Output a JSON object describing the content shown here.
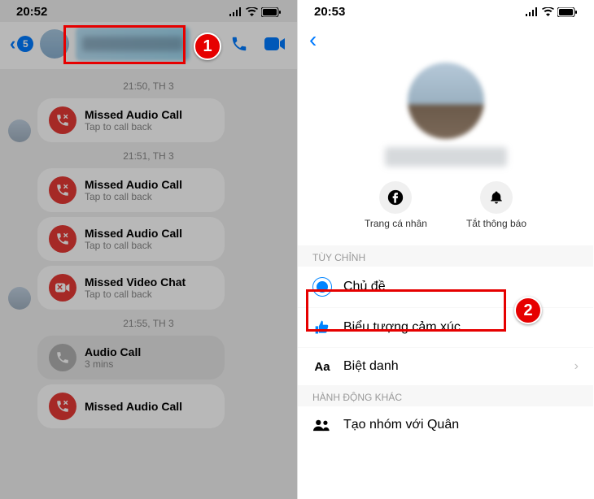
{
  "left": {
    "status_time": "20:52",
    "back_count": "5",
    "timestamps": [
      "21:50, TH 3",
      "21:51, TH 3",
      "21:55, TH 3"
    ],
    "calls": [
      {
        "title": "Missed Audio Call",
        "sub": "Tap to call back",
        "icon": "phone-x",
        "color": "red"
      },
      {
        "title": "Missed Audio Call",
        "sub": "Tap to call back",
        "icon": "phone-x",
        "color": "red"
      },
      {
        "title": "Missed Audio Call",
        "sub": "Tap to call back",
        "icon": "phone-x",
        "color": "red"
      },
      {
        "title": "Missed Video Chat",
        "sub": "Tap to call back",
        "icon": "video-x",
        "color": "red"
      },
      {
        "title": "Audio Call",
        "sub": "3 mins",
        "icon": "phone",
        "color": "grey"
      },
      {
        "title": "Missed Audio Call",
        "sub": "",
        "icon": "phone-x",
        "color": "red"
      }
    ],
    "callout": "1"
  },
  "right": {
    "status_time": "20:53",
    "profile_actions": {
      "profile_label": "Trang cá nhân",
      "mute_label": "Tắt thông báo"
    },
    "section_customize": "TÙY CHỈNH",
    "items": {
      "theme": "Chủ đề",
      "emoji": "Biểu tượng cảm xúc",
      "nickname": "Biệt danh"
    },
    "section_other": "HÀNH ĐỘNG KHÁC",
    "create_group": "Tạo nhóm với Quân",
    "callout": "2"
  }
}
